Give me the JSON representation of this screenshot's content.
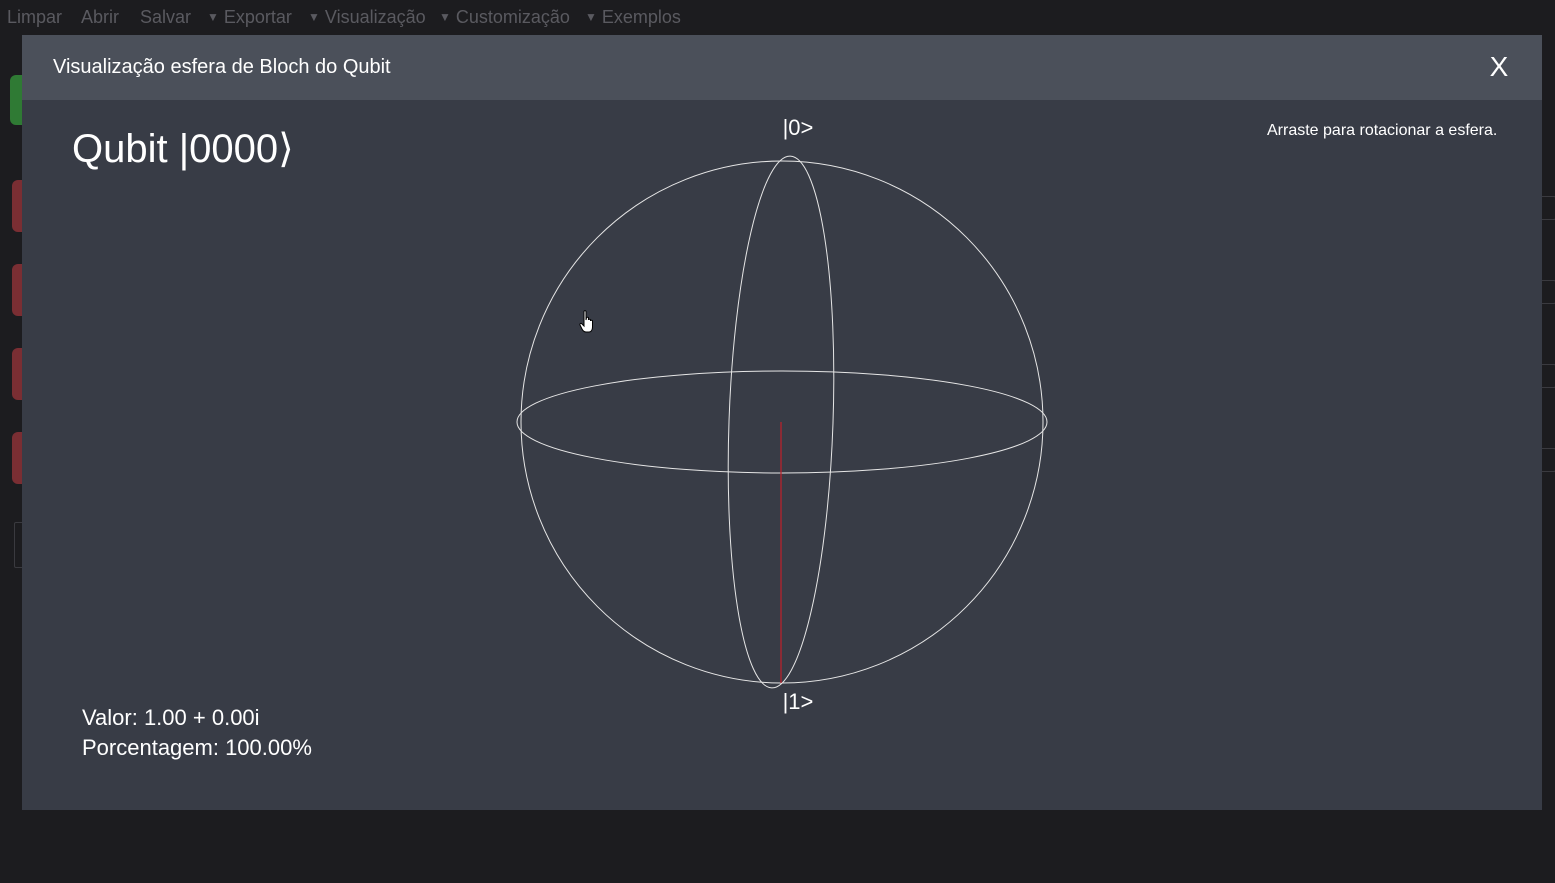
{
  "menu": {
    "items": [
      {
        "label": "Limpar",
        "caret": false
      },
      {
        "label": "Abrir",
        "caret": false
      },
      {
        "label": "Salvar",
        "caret": false
      },
      {
        "label": "Exportar",
        "caret": true
      },
      {
        "label": "Visualização",
        "caret": true
      },
      {
        "label": "Customização",
        "caret": true
      },
      {
        "label": "Exemplos",
        "caret": true
      }
    ]
  },
  "modal": {
    "title": "Visualização esfera de Bloch do Qubit",
    "close_label": "X",
    "qubit_label": "Qubit |0000⟩",
    "hint": "Arraste para rotacionar a esfera.",
    "value_text": "Valor: 1.00 + 0.00i",
    "percent_text": "Porcentagem: 100.00%",
    "state_top_label": "|0>",
    "state_bottom_label": "|1>"
  },
  "colors": {
    "background": "#1c1c1f",
    "modal_body": "#383c46",
    "modal_header": "#4b505a",
    "sphere_lines": "#e6e6e6",
    "state_vector": "#c0202a"
  },
  "icons": {
    "close": "close-icon",
    "caret": "chevron-down-icon",
    "cursor": "hand-pointer-icon"
  }
}
